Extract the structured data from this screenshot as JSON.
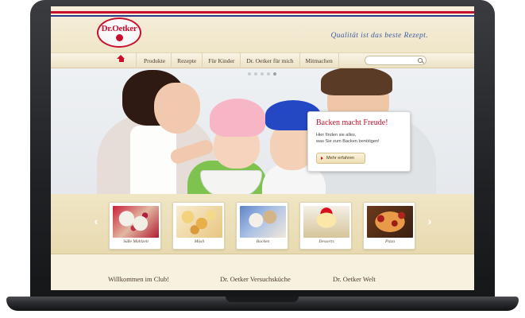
{
  "brand": {
    "logo_text": "Dr.Oetker",
    "tagline": "Qualität ist das beste Rezept.",
    "red": "#c8102e",
    "blue": "#2a3a8c"
  },
  "nav": {
    "home_icon": "home-icon",
    "items": [
      {
        "label": "Produkte"
      },
      {
        "label": "Rezepte"
      },
      {
        "label": "Für Kinder"
      },
      {
        "label": "Dr. Oetker für mich"
      },
      {
        "label": "Mitmachen"
      }
    ],
    "search_icon": "search-icon"
  },
  "hero": {
    "title": "Backen macht Freude!",
    "text": "Hier finden sie alles,\nwas Sie zum Backen benötigen!",
    "button_label": "Mehr erfahren",
    "slide_count": 5,
    "active_slide": 4
  },
  "categories": {
    "prev_label": "‹",
    "next_label": "›",
    "items": [
      {
        "label": "Süße Mahlzeit"
      },
      {
        "label": "Müsli"
      },
      {
        "label": "Backen"
      },
      {
        "label": "Desserts"
      },
      {
        "label": "Pizza"
      }
    ]
  },
  "bottom": {
    "headings": [
      {
        "label": "Willkommen im Club!"
      },
      {
        "label": "Dr. Oetker Versuchsküche"
      },
      {
        "label": "Dr. Oetker Welt"
      }
    ]
  }
}
